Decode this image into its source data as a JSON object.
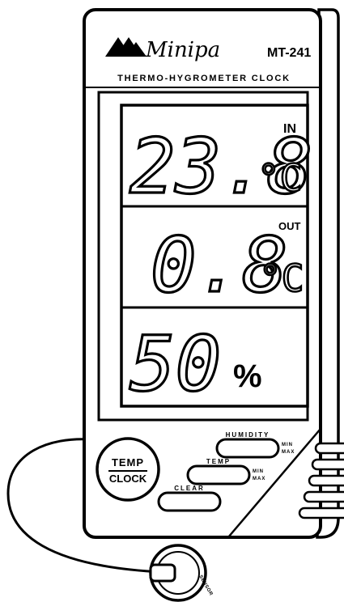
{
  "brand": {
    "name": "Minipa",
    "model": "MT-241",
    "subtitle": "THERMO-HYGROMETER CLOCK"
  },
  "display": {
    "indoor": {
      "value": "23.8",
      "unit": "°C",
      "label": "IN"
    },
    "outdoor": {
      "value": "0.8",
      "unit": "°C",
      "label": "OUT"
    },
    "humidity": {
      "value": "50",
      "unit": "%"
    }
  },
  "buttons": {
    "temp_clock": {
      "line1": "TEMP",
      "line2": "CLOCK"
    },
    "humidity": "HUMIDITY",
    "temp": "TEMP",
    "clear": "CLEAR",
    "minmax_1": {
      "min": "MIN",
      "max": "MAX"
    },
    "minmax_2": {
      "min": "MIN",
      "max": "MAX"
    }
  },
  "sensor": {
    "label": "SENSOR"
  }
}
